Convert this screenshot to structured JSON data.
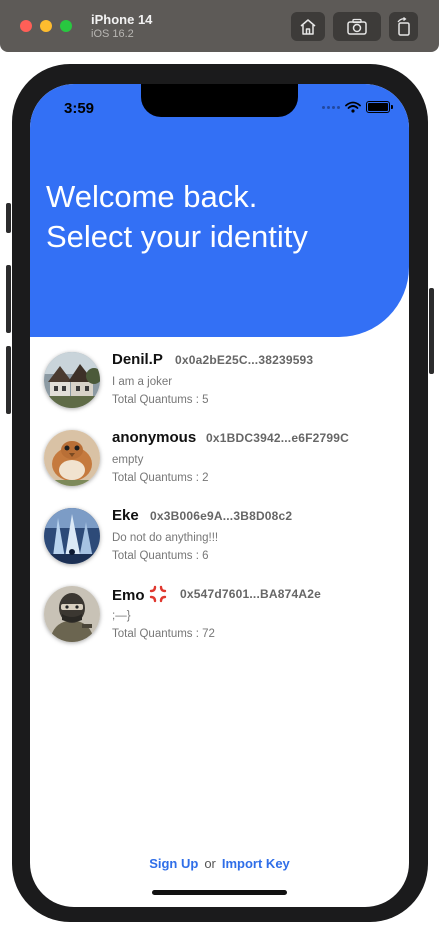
{
  "simulator": {
    "device": "iPhone 14",
    "os": "iOS 16.2",
    "icons": [
      "home-icon",
      "screenshot-icon",
      "rotate-icon"
    ]
  },
  "status_bar": {
    "time": "3:59"
  },
  "header": {
    "line1": "Welcome back.",
    "line2": "Select your identity",
    "color": "#3370f5"
  },
  "identities": [
    {
      "name": "Denil.P",
      "address": "0x0a2bE25C...38239593",
      "description": "I am a joker",
      "total": "Total Quantums : 5",
      "avatar": "village-house-avatar"
    },
    {
      "name": "anonymous",
      "address": "0x1BDC3942...e6F2799C",
      "description": "empty",
      "total": "Total Quantums : 2",
      "avatar": "bird-avatar"
    },
    {
      "name": "Eke",
      "address": "0x3B006e9A...3B8D08c2",
      "description": "Do not do anything!!!",
      "total": "Total Quantums : 6",
      "avatar": "ice-waterfall-avatar"
    },
    {
      "name": "Emo",
      "name_icon": "anger-icon",
      "address": "0x547d7601...BA874A2e",
      "description": ";—}",
      "total": "Total Quantums : 72",
      "avatar": "masked-soldier-avatar"
    }
  ],
  "footer": {
    "sign_up": "Sign Up",
    "or": "or",
    "import_key": "Import Key",
    "link_color": "#2f6ee8"
  }
}
